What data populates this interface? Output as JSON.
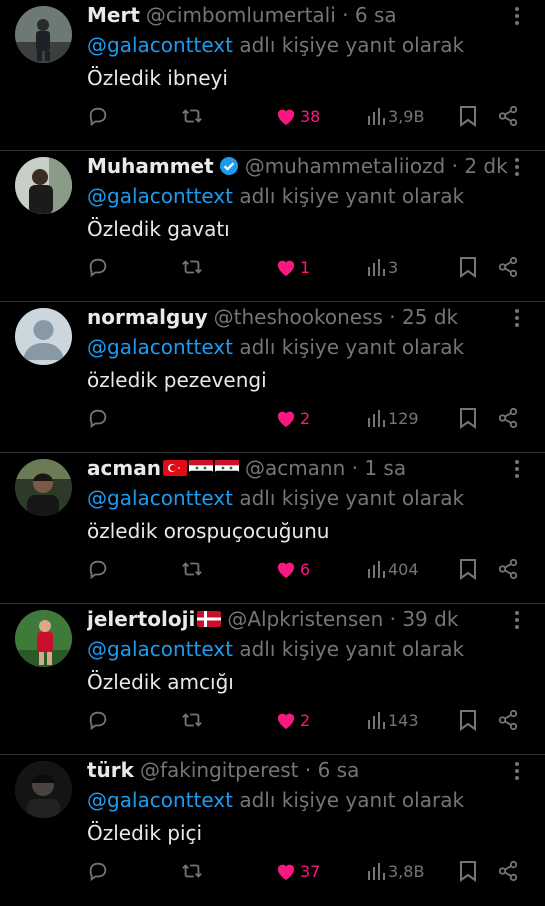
{
  "reply_prefix_suffix": " adlı kişiye yanıt olarak",
  "reply_mention": "@galaconttext",
  "colors": {
    "like": "#f91880",
    "mention": "#1d9bf0",
    "muted": "#71767b",
    "verified": "#1d9bf0"
  },
  "tweets": [
    {
      "name": "Mert",
      "handle": "@cimbomlumertali",
      "time": " · 6 sa",
      "text": "Özledik ibneyi",
      "likes": "38",
      "views": "3,9B",
      "verified": false,
      "flags": []
    },
    {
      "name": "Muhammet",
      "handle": "@muhammetaliiozd",
      "time": " · 2 dk",
      "text": "Özledik gavatı",
      "likes": "1",
      "views": "3",
      "verified": true,
      "flags": []
    },
    {
      "name": "normalguy",
      "handle": "@theshookoness",
      "time": " · 25 dk",
      "text": "özledik pezevengi",
      "likes": "2",
      "views": "129",
      "verified": false,
      "flags": []
    },
    {
      "name": "acman",
      "handle": "@acmann",
      "time": " · 1 sa",
      "text": "özledik orospuçocuğunu",
      "likes": "6",
      "views": "404",
      "verified": false,
      "flags": [
        "turkey-flag",
        "syria-flag",
        "syria-flag"
      ]
    },
    {
      "name": "jelertoloji",
      "handle": "@Alpkristensen",
      "time": " · 39 dk",
      "text": "Özledik amcığı",
      "likes": "2",
      "views": "143",
      "verified": false,
      "flags": [
        "denmark-flag"
      ]
    },
    {
      "name": "türk",
      "handle": "@fakingitperest",
      "time": " · 6 sa",
      "text": "Özledik piçi",
      "likes": "37",
      "views": "3,8B",
      "verified": false,
      "flags": []
    }
  ]
}
